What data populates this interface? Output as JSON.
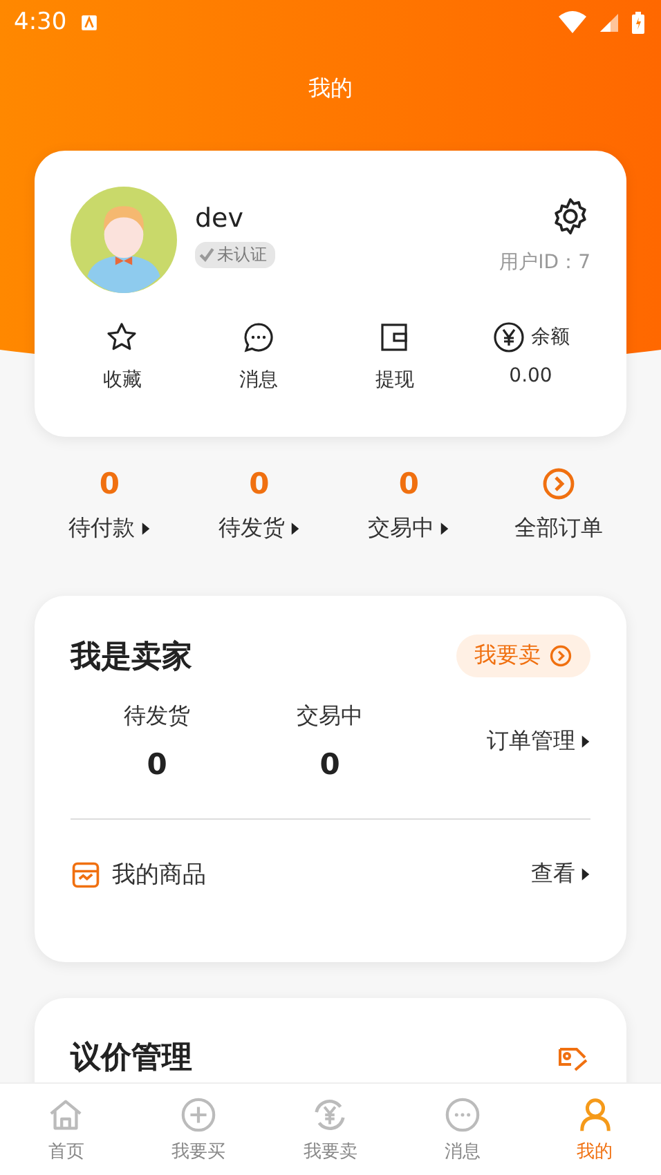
{
  "status_bar": {
    "time": "4:30"
  },
  "header": {
    "title": "我的"
  },
  "profile": {
    "username": "dev",
    "verification_badge": "未认证",
    "verified": false,
    "user_id": "用户ID：7"
  },
  "quick_actions": [
    {
      "kind": "star",
      "label": "收藏"
    },
    {
      "kind": "message",
      "label": "消息"
    },
    {
      "kind": "wallet",
      "label": "提现"
    },
    {
      "kind": "balance",
      "label": "余额",
      "value": "0.00"
    }
  ],
  "orders": [
    {
      "kind": "count",
      "count": "0",
      "label": "待付款"
    },
    {
      "kind": "count",
      "count": "0",
      "label": "待发货"
    },
    {
      "kind": "count",
      "count": "0",
      "label": "交易中"
    },
    {
      "kind": "all",
      "label": "全部订单"
    }
  ],
  "seller": {
    "title": "我是卖家",
    "sell_button": "我要卖",
    "stats": [
      {
        "label": "待发货",
        "value": "0"
      },
      {
        "label": "交易中",
        "value": "0"
      }
    ],
    "order_management": "订单管理",
    "products": {
      "label": "我的商品",
      "action": "查看"
    }
  },
  "bargain": {
    "title": "议价管理"
  },
  "bottom_nav": [
    {
      "kind": "home",
      "label": "首页",
      "selected": false
    },
    {
      "kind": "buy",
      "label": "我要买",
      "selected": false
    },
    {
      "kind": "sell",
      "label": "我要卖",
      "selected": false
    },
    {
      "kind": "message",
      "label": "消息",
      "selected": false
    },
    {
      "kind": "me",
      "label": "我的",
      "selected": true
    }
  ]
}
